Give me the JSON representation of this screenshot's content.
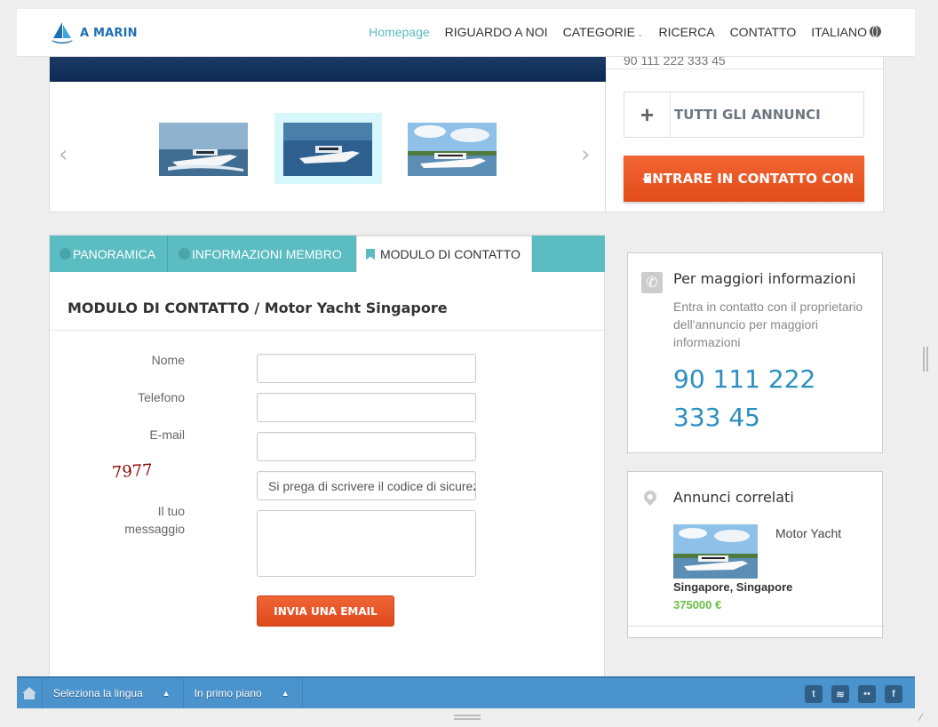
{
  "header": {
    "logo_text": "A MARIN",
    "nav": [
      {
        "label": "Homepage",
        "active": true
      },
      {
        "label": "RIGUARDO A NOI"
      },
      {
        "label": "CATEGORIE"
      },
      {
        "label": "RICERCA"
      },
      {
        "label": "CONTATTO"
      },
      {
        "label": "ITALIANO"
      }
    ]
  },
  "sidebar_top": {
    "phone": "90 111 222 333 45",
    "all_ads_label": "TUTTI GLI ANNUNCI",
    "contact_label": "ENTRARE IN CONTATTO CON"
  },
  "tabs": [
    {
      "label": "PANORAMICA"
    },
    {
      "label": "INFORMAZIONI MEMBRO"
    },
    {
      "label": "MODULO DI CONTATTO",
      "selected": true
    }
  ],
  "form": {
    "title": "MODULO DI CONTATTO / Motor Yacht Singapore",
    "name_label": "Nome",
    "phone_label": "Telefono",
    "email_label": "E-mail",
    "captcha_code": "7977",
    "captcha_placeholder": "Si prega di scrivere il codice di sicurezza",
    "message_label_1": "Il tuo",
    "message_label_2": "messaggio",
    "send_label": "INVIA UNA EMAIL"
  },
  "info": {
    "title": "Per maggiori informazioni",
    "text": "Entra in contatto con il proprietario dell'annuncio per maggiori informazioni",
    "phone_line1": "90 111 222",
    "phone_line2": "333 45"
  },
  "related": {
    "title": "Annunci correlati",
    "item_name": "Motor Yacht",
    "item_location": "Singapore, Singapore",
    "item_price": "375000 €"
  },
  "bottombar": {
    "language_label": "Seleziona la lingua",
    "featured_label": "In primo piano",
    "social": [
      "twitter-icon",
      "rss-icon",
      "flickr-icon",
      "facebook-icon"
    ]
  },
  "colors": {
    "accent": "#5bbcc2",
    "cta": "#e9541f",
    "phone": "#2a8fc0",
    "price": "#6abe45",
    "bar": "#4a93cc"
  }
}
